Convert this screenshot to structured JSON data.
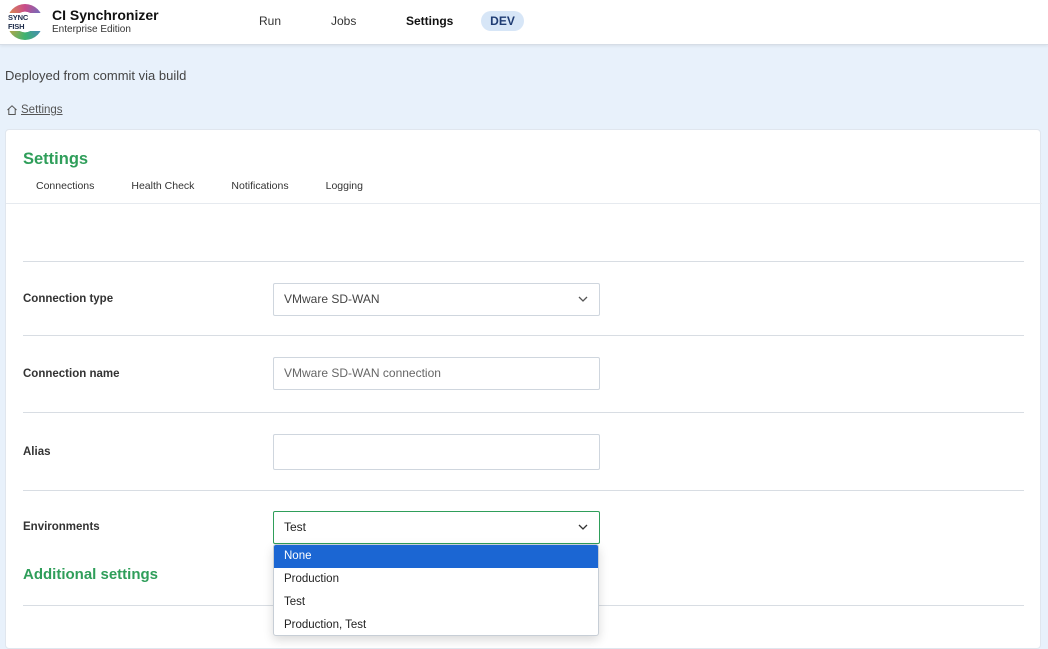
{
  "app": {
    "logo_text": "SYNC FISH",
    "title": "CI Synchronizer",
    "subtitle": "Enterprise Edition"
  },
  "nav": {
    "run": "Run",
    "jobs": "Jobs",
    "settings": "Settings",
    "env_badge": "DEV"
  },
  "deployed_text": "Deployed from commit via build",
  "breadcrumb": {
    "icon": "home-icon",
    "label": "Settings"
  },
  "page": {
    "title": "Settings",
    "tabs": [
      "Connections",
      "Health Check",
      "Notifications",
      "Logging"
    ]
  },
  "form": {
    "connection_type": {
      "label": "Connection type",
      "value": "VMware SD-WAN"
    },
    "connection_name": {
      "label": "Connection name",
      "placeholder": "VMware SD-WAN connection"
    },
    "alias": {
      "label": "Alias",
      "value": ""
    },
    "environments": {
      "label": "Environments",
      "value": "Test",
      "options": [
        "None",
        "Production",
        "Test",
        "Production, Test"
      ],
      "highlighted": "None"
    }
  },
  "additional_settings_title": "Additional settings",
  "colors": {
    "accent": "#2f9e5a",
    "highlight": "#1b66d3",
    "badge_bg": "#d7e6f7",
    "page_bg": "#e8f1fb"
  }
}
